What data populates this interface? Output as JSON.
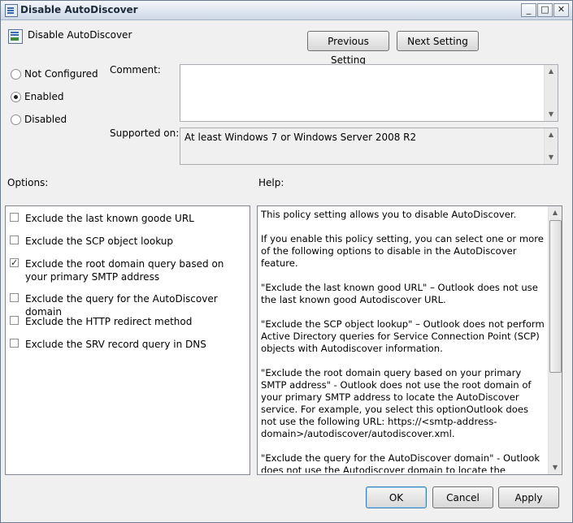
{
  "window": {
    "title": "Disable AutoDiscover",
    "controls": {
      "minimize": "_",
      "maximize": "□",
      "close": "✕"
    }
  },
  "header": {
    "policy_name": "Disable AutoDiscover",
    "prev_label": "Previous Setting",
    "next_label": "Next Setting"
  },
  "state": {
    "options": [
      {
        "label": "Not Configured",
        "selected": false
      },
      {
        "label": "Enabled",
        "selected": true
      },
      {
        "label": "Disabled",
        "selected": false
      }
    ]
  },
  "comment": {
    "label": "Comment:",
    "value": ""
  },
  "supported": {
    "label": "Supported on:",
    "value": "At least Windows 7 or Windows Server 2008 R2"
  },
  "options_label": "Options:",
  "help_label": "Help:",
  "options": [
    {
      "label": "Exclude the last known goode URL",
      "checked": false
    },
    {
      "label": "Exclude the SCP object lookup",
      "checked": false
    },
    {
      "label": "Exclude the root domain query based on your primary SMTP address",
      "checked": true
    },
    {
      "label": "Exclude the query for the AutoDiscover domain",
      "checked": false
    },
    {
      "label": "Exclude the HTTP redirect method",
      "checked": false
    },
    {
      "label": "Exclude the SRV record query in DNS",
      "checked": false
    }
  ],
  "help": {
    "paragraphs": [
      "This policy setting allows you to disable AutoDiscover.",
      "If you enable this policy setting, you can select one or more of the following options to disable in the AutoDiscover feature.",
      "\"Exclude the last known good URL\" – Outlook does not use the last known good Autodiscover URL.",
      "\"Exclude the SCP object lookup\" – Outlook does not perform Active Directory queries for Service Connection Point (SCP) objects with Autodiscover information.",
      "\"Exclude the root domain query based on your primary SMTP address\" - Outlook does not use the root domain of your primary SMTP address to locate the AutoDiscover service. For example, you select this optionOutlook does not use the following URL: https://<smtp-address-domain>/autodiscover/autodiscover.xml.",
      "\"Exclude the query for the AutoDiscover domain\" - Outlook does not use the Autodiscover domain to locate the Autodiscover service. For example, Outlook does not use the following URL:"
    ]
  },
  "footer": {
    "ok_label": "OK",
    "cancel_label": "Cancel",
    "apply_label": "Apply"
  }
}
